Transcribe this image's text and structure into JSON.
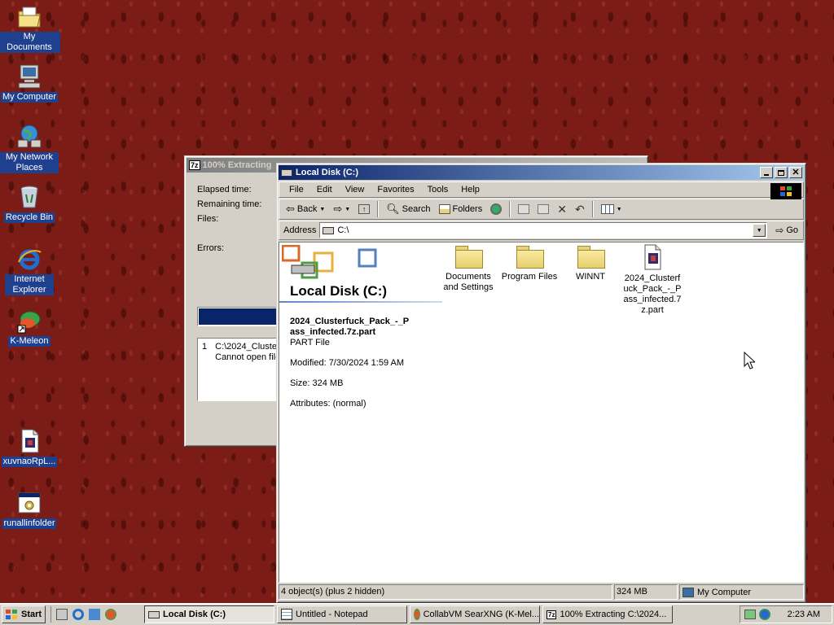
{
  "desktop": {
    "icons": [
      {
        "label": "My Documents",
        "icon": "my-documents-icon"
      },
      {
        "label": "My Computer",
        "icon": "my-computer-icon"
      },
      {
        "label": "My Network Places",
        "icon": "network-places-icon"
      },
      {
        "label": "Recycle Bin",
        "icon": "recycle-bin-icon"
      },
      {
        "label": "Internet Explorer",
        "icon": "internet-explorer-icon"
      },
      {
        "label": "K-Meleon",
        "icon": "k-meleon-icon"
      },
      {
        "label": "xuvnaoRpL...",
        "icon": "file-icon"
      },
      {
        "label": "runallinfolder",
        "icon": "batch-file-icon"
      }
    ]
  },
  "extract_window": {
    "title": "100% Extracting",
    "title_icon": "7z",
    "fields": {
      "elapsed": "Elapsed time:",
      "remaining": "Remaining time:",
      "files": "Files:",
      "errors": "Errors:"
    },
    "log": {
      "index": "1",
      "line1": "C:\\2024_Cluste",
      "line2": "Cannot open file"
    },
    "progress_percent": 100
  },
  "explorer": {
    "title": "Local Disk (C:)",
    "menu": [
      "File",
      "Edit",
      "View",
      "Favorites",
      "Tools",
      "Help"
    ],
    "toolbar": {
      "back": "Back",
      "search": "Search",
      "folders": "Folders"
    },
    "address": {
      "label": "Address",
      "value": "C:\\",
      "go": "Go"
    },
    "sidepanel": {
      "heading": "Local Disk (C:)",
      "filename": "2024_Clusterfuck_Pack_-_Pass_infected.7z.part",
      "filetype": "PART File",
      "modified": "Modified: 7/30/2024 1:59 AM",
      "size": "Size: 324 MB",
      "attributes": "Attributes: (normal)"
    },
    "items": [
      {
        "label": "Documents and Settings",
        "type": "folder"
      },
      {
        "label": "Program Files",
        "type": "folder"
      },
      {
        "label": "WINNT",
        "type": "folder"
      },
      {
        "label": "2024_Clusterfuck_Pack_-_Pass_infected.7z.part",
        "type": "file"
      }
    ],
    "status": {
      "objects": "4 object(s) (plus 2 hidden)",
      "size": "324 MB",
      "zone": "My Computer"
    }
  },
  "taskbar": {
    "start": "Start",
    "buttons": [
      {
        "label": "Local Disk (C:)",
        "icon": "drive-icon",
        "active": true
      },
      {
        "label": "Untitled - Notepad",
        "icon": "notepad-icon",
        "active": false
      },
      {
        "label": "CollabVM SearXNG (K-Mel...",
        "icon": "k-meleon-icon",
        "active": false
      },
      {
        "label": "100% Extracting C:\\2024...",
        "icon": "7z-icon",
        "active": false
      }
    ],
    "clock": "2:23 AM"
  }
}
